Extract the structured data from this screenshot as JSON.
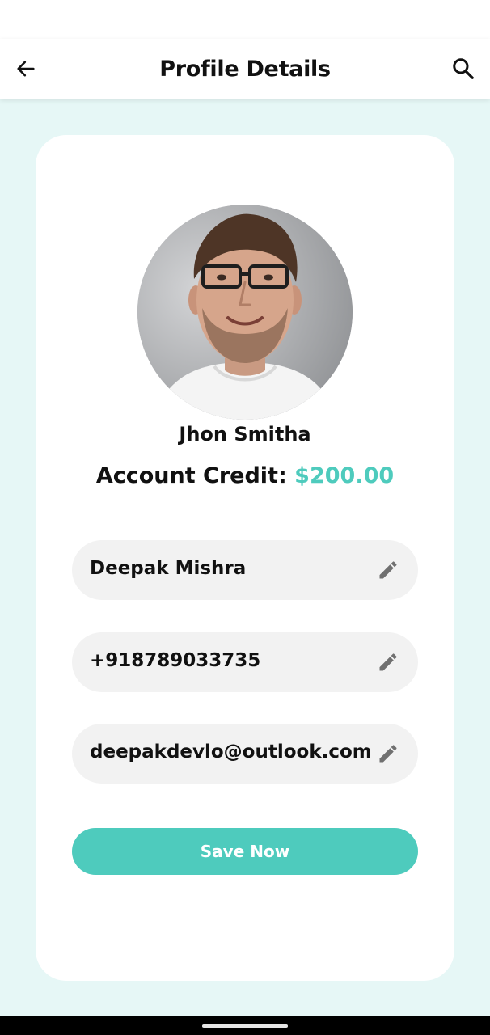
{
  "app_bar": {
    "title": "Profile Details",
    "back_icon": "arrow-left-icon",
    "search_icon": "search-icon"
  },
  "profile": {
    "avatar": "user-photo",
    "name": "Jhon Smitha",
    "credit_label": "Account Credit: ",
    "credit_amount": "$200.00"
  },
  "form": {
    "fields": [
      {
        "value": "Deepak Mishra",
        "icon": "pencil-icon"
      },
      {
        "value": "+918789033735",
        "icon": "pencil-icon"
      },
      {
        "value": "deepakdevlo@outlook.com",
        "icon": "pencil-icon"
      }
    ],
    "save_label": "Save Now"
  },
  "colors": {
    "accent": "#4ecbbd",
    "background": "#e6f7f6",
    "card": "#ffffff",
    "field": "#f2f2f2"
  }
}
